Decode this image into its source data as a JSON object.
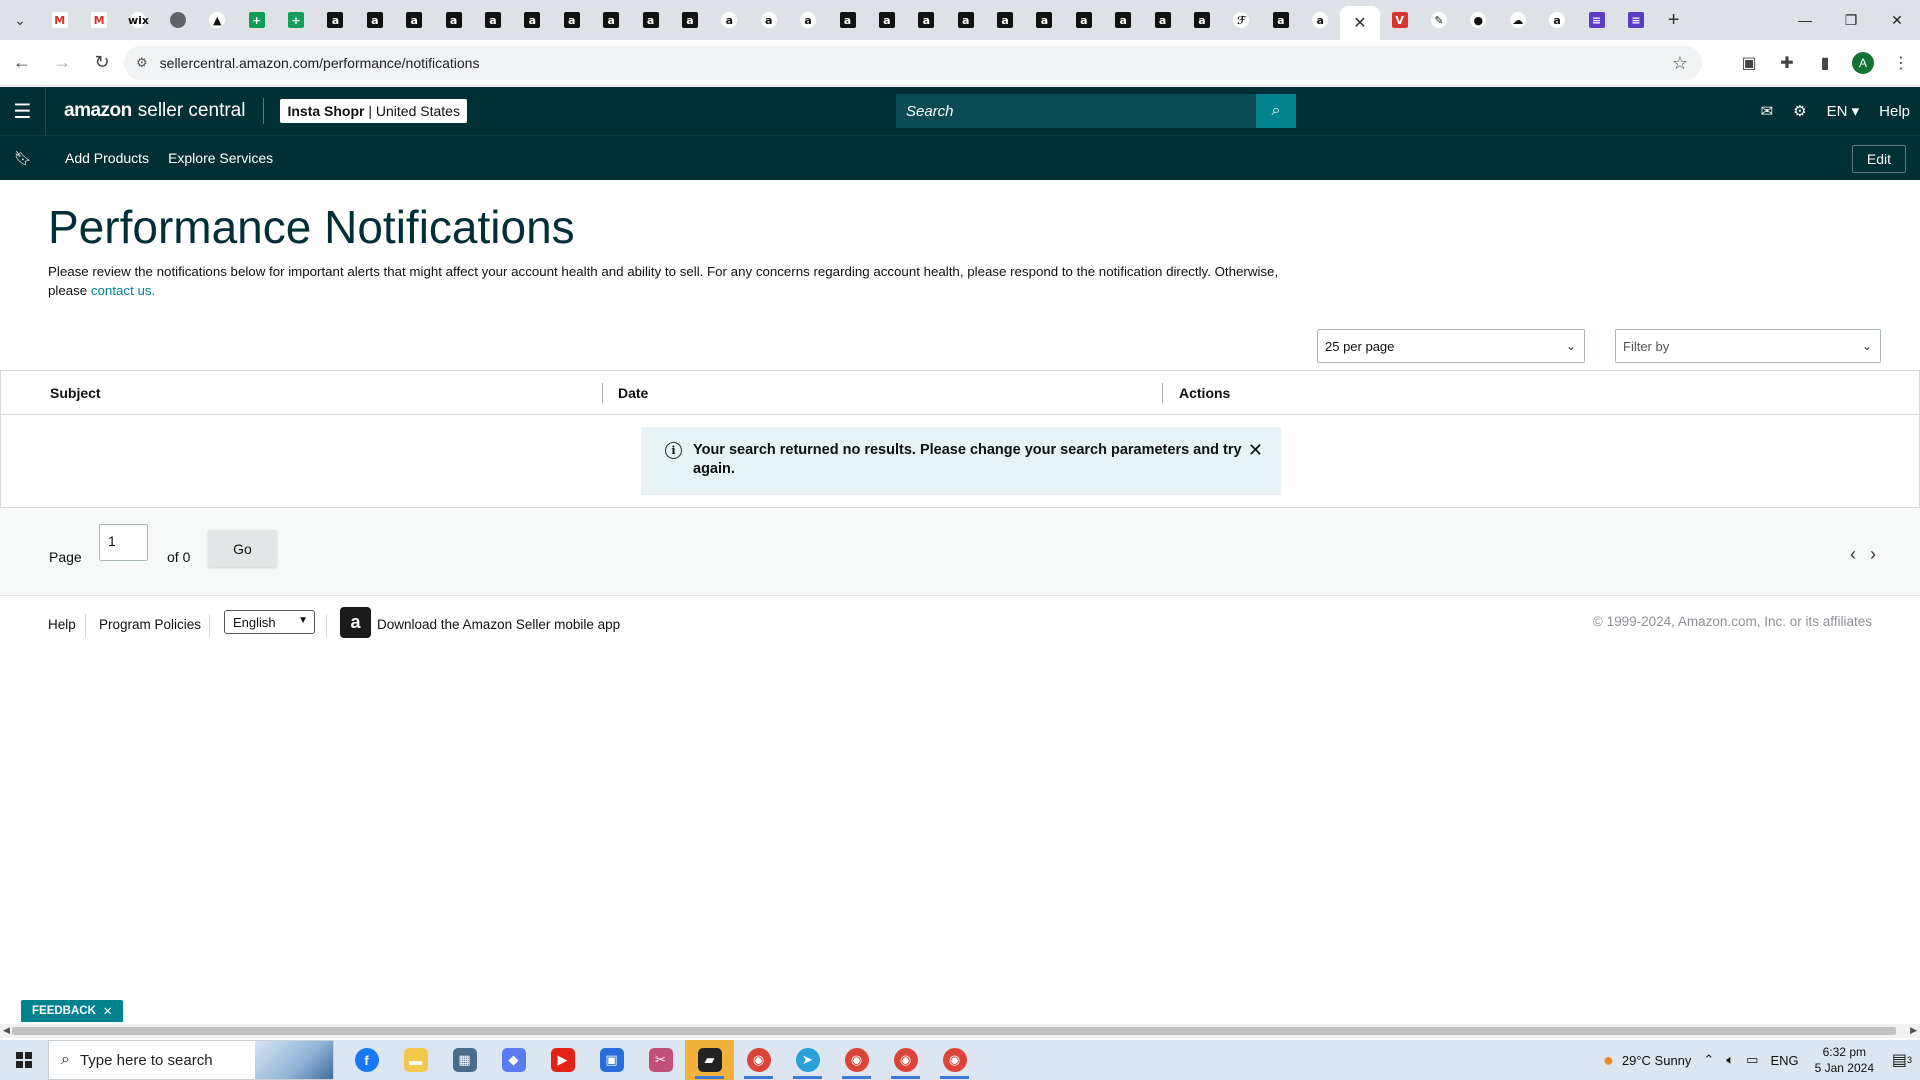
{
  "browser": {
    "url": "sellercentral.amazon.com/performance/notifications",
    "tabs": [
      {
        "icon": "gmail",
        "letter": "M"
      },
      {
        "icon": "gmail",
        "letter": "M"
      },
      {
        "icon": "wix",
        "letter": "wix"
      },
      {
        "icon": "globe",
        "letter": ""
      },
      {
        "icon": "drive",
        "letter": "▲"
      },
      {
        "icon": "sheets",
        "letter": "+"
      },
      {
        "icon": "sheets",
        "letter": "+"
      },
      {
        "icon": "amazon-a",
        "letter": "a"
      },
      {
        "icon": "amazon-a",
        "letter": "a"
      },
      {
        "icon": "amazon-a",
        "letter": "a"
      },
      {
        "icon": "amazon-a",
        "letter": "a"
      },
      {
        "icon": "amazon-a",
        "letter": "a"
      },
      {
        "icon": "amazon-a",
        "letter": "a"
      },
      {
        "icon": "amazon-a",
        "letter": "a"
      },
      {
        "icon": "amazon-a",
        "letter": "a"
      },
      {
        "icon": "amazon-a",
        "letter": "a"
      },
      {
        "icon": "amazon-a",
        "letter": "a"
      },
      {
        "icon": "amazon-smile",
        "letter": "a"
      },
      {
        "icon": "amazon-smile",
        "letter": "a"
      },
      {
        "icon": "amazon-smile",
        "letter": "a"
      },
      {
        "icon": "amazon-a",
        "letter": "a"
      },
      {
        "icon": "amazon-a",
        "letter": "a"
      },
      {
        "icon": "amazon-a",
        "letter": "a"
      },
      {
        "icon": "amazon-a",
        "letter": "a"
      },
      {
        "icon": "amazon-a",
        "letter": "a"
      },
      {
        "icon": "amazon-a",
        "letter": "a"
      },
      {
        "icon": "amazon-a",
        "letter": "a"
      },
      {
        "icon": "amazon-a",
        "letter": "a"
      },
      {
        "icon": "amazon-a",
        "letter": "a"
      },
      {
        "icon": "amazon-a",
        "letter": "a"
      },
      {
        "icon": "script",
        "letter": "ℱ"
      },
      {
        "icon": "amazon-a",
        "letter": "a"
      },
      {
        "icon": "amazon-smile",
        "letter": "a"
      }
    ],
    "tabs_after": [
      {
        "icon": "red-v",
        "letter": "V"
      },
      {
        "icon": "pencil",
        "letter": "✎"
      },
      {
        "icon": "red-circle",
        "letter": "●"
      },
      {
        "icon": "blue-cloud",
        "letter": "☁"
      },
      {
        "icon": "amazon-smile",
        "letter": "a"
      },
      {
        "icon": "purple-form",
        "letter": "≡"
      },
      {
        "icon": "purple-form",
        "letter": "≡"
      }
    ],
    "profile_initial": "A"
  },
  "header": {
    "logo_brand": "amazon",
    "logo_product": "seller central",
    "store_name": "Insta Shopr",
    "store_region": "United States",
    "search_placeholder": "Search",
    "language": "EN",
    "help": "Help"
  },
  "subnav": {
    "links": [
      "Add Products",
      "Explore Services"
    ],
    "edit": "Edit"
  },
  "page": {
    "title": "Performance Notifications",
    "description": "Please review the notifications below for important alerts that might affect your account health and ability to sell. For any concerns regarding account health, please respond to the notification directly. Otherwise, please",
    "contact_link": "contact us.",
    "per_page": "25 per page",
    "filter_placeholder": "Filter by"
  },
  "table": {
    "columns": [
      "Subject",
      "Date",
      "Actions"
    ],
    "empty_message": "Your search returned no results. Please change your search parameters and try again."
  },
  "pager": {
    "page_label": "Page",
    "current_page": "1",
    "of_label": "of 0",
    "go": "Go"
  },
  "footer": {
    "help": "Help",
    "program_policies": "Program Policies",
    "language": "English",
    "app_link": "Download the Amazon Seller mobile app",
    "copyright": "© 1999-2024, Amazon.com, Inc. or its affiliates"
  },
  "feedback": "FEEDBACK",
  "taskbar": {
    "search_placeholder": "Type here to search",
    "weather": "29°C  Sunny",
    "lang": "ENG",
    "time": "6:32 pm",
    "date": "5 Jan 2024",
    "notifications": "3",
    "apps": [
      "facebook",
      "file-explorer",
      "calculator",
      "copilot",
      "youtube",
      "store",
      "snipping-tool",
      "sticky-notes",
      "chrome",
      "telegram",
      "chrome",
      "chrome",
      "chrome"
    ]
  },
  "colors": {
    "header_bg": "#002f36",
    "accent_teal": "#008296",
    "alert_bg": "#e6f2f3"
  }
}
